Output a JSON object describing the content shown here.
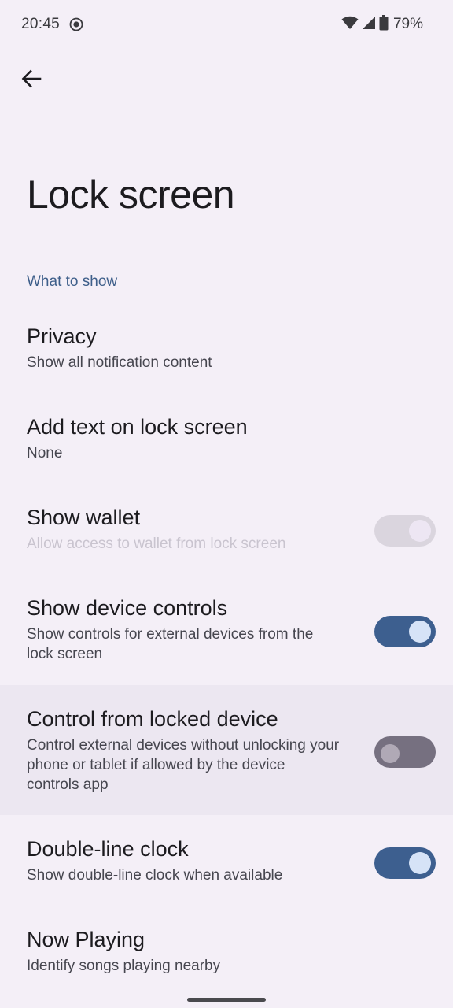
{
  "status_bar": {
    "time": "20:45",
    "battery_percent": "79%",
    "icons": [
      "screen-record-icon",
      "wifi-icon",
      "cell-signal-icon",
      "battery-icon"
    ]
  },
  "header": {
    "back_icon": "back-arrow-icon",
    "title": "Lock screen"
  },
  "section": {
    "header": "What to show"
  },
  "settings": [
    {
      "title": "Privacy",
      "summary": "Show all notification content",
      "toggle": null
    },
    {
      "title": "Add text on lock screen",
      "summary": "None",
      "toggle": null
    },
    {
      "title": "Show wallet",
      "summary": "Allow access to wallet from lock screen",
      "toggle": "on",
      "enabled": false
    },
    {
      "title": "Show device controls",
      "summary": "Show controls for external devices from the lock screen",
      "toggle": "on",
      "enabled": true
    },
    {
      "title": "Control from locked device",
      "summary": "Control external devices without unlocking your phone or tablet if allowed by the device controls app",
      "toggle": "off",
      "enabled": true
    },
    {
      "title": "Double-line clock",
      "summary": "Show double-line clock when available",
      "toggle": "on",
      "enabled": true
    },
    {
      "title": "Now Playing",
      "summary": "Identify songs playing nearby",
      "toggle": null
    }
  ],
  "colors": {
    "background": "#f4eff7",
    "accent": "#3d5f8f",
    "section_header": "#3e5f8a",
    "highlight_row": "#ece7f1"
  }
}
